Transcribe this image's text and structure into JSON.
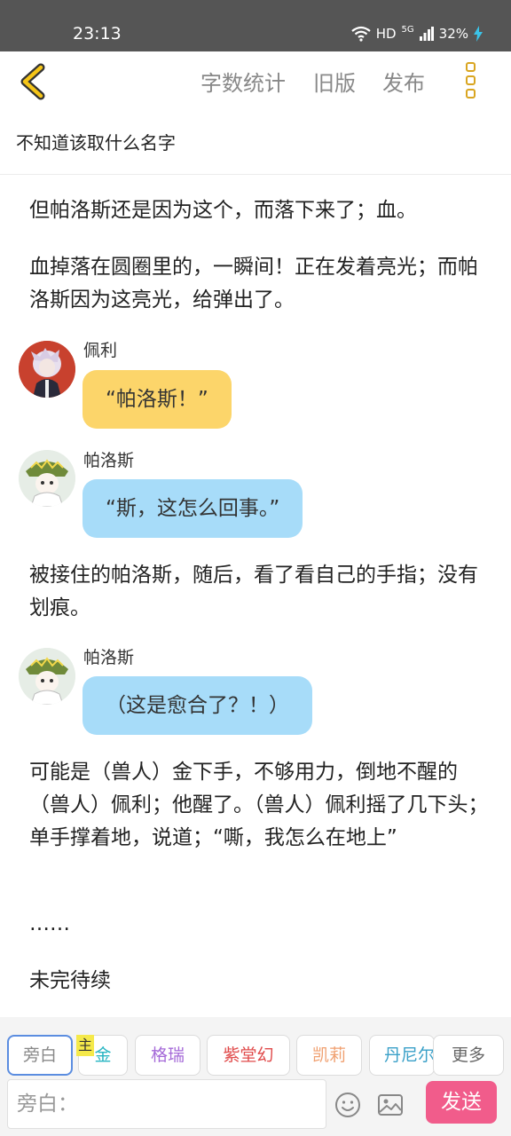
{
  "status": {
    "time": "23:13",
    "network": "HD",
    "signal": "5G",
    "battery": "32%"
  },
  "toolbar": {
    "word_count": "字数统计",
    "old_version": "旧版",
    "publish": "发布"
  },
  "doc_title": "不知道该取什么名字",
  "content": {
    "p1": "但帕洛斯还是因为这个，而落下来了；血。",
    "p2": "血掉落在圆圈里的，一瞬间！正在发着亮光；而帕洛斯因为这亮光，给弹出了。",
    "msg1": {
      "speaker": "佩利",
      "text": "“帕洛斯！”"
    },
    "msg2": {
      "speaker": "帕洛斯",
      "text": "“斯，这怎么回事。”"
    },
    "p3": "被接住的帕洛斯，随后，看了看自己的手指；没有划痕。",
    "msg3": {
      "speaker": "帕洛斯",
      "text": "（这是愈合了？！）"
    },
    "p4": "可能是（兽人）金下手，不够用力，倒地不醒的（兽人）佩利；他醒了。（兽人）佩利摇了几下头；单手撑着地，说道；“嘶，我怎么在地上”",
    "p5": "……",
    "p6": "未完待续"
  },
  "roles": {
    "narration": "旁白",
    "main_tag": "主",
    "jin": "金",
    "gerui": "格瑞",
    "zitanghuan": "紫堂幻",
    "kaili": "凯莉",
    "danier": "丹尼尔",
    "more": "更多"
  },
  "role_colors": {
    "jin": "#27b5c2",
    "gerui": "#a56ad8",
    "zitanghuan": "#e04a4a",
    "kaili": "#f0a070",
    "danier": "#3aa0c8"
  },
  "input": {
    "placeholder": "旁白："
  },
  "send_label": "发送"
}
